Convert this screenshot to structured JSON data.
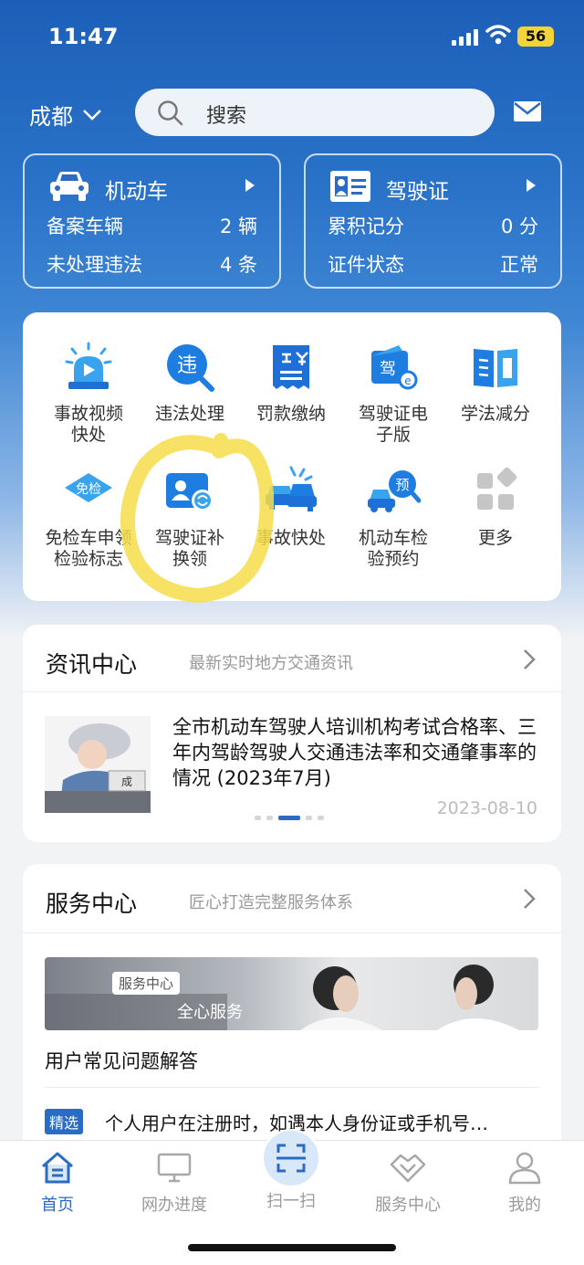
{
  "status": {
    "time": "11:47",
    "battery": "56"
  },
  "header": {
    "city": "成都",
    "search_placeholder": "搜索"
  },
  "vehicle_card": {
    "title": "机动车",
    "rows": [
      {
        "label": "备案车辆",
        "value": "2",
        "unit": "辆"
      },
      {
        "label": "未处理违法",
        "value": "4",
        "unit": "条"
      }
    ]
  },
  "license_card": {
    "title": "驾驶证",
    "rows": [
      {
        "label": "累积记分",
        "value": "0",
        "unit": "分"
      },
      {
        "label": "证件状态",
        "value": "正常",
        "unit": ""
      }
    ]
  },
  "services": [
    {
      "label": "事故视频\n快处",
      "icon": "alarm-video-icon"
    },
    {
      "label": "违法处理",
      "icon": "violation-search-icon"
    },
    {
      "label": "罚款缴纳",
      "icon": "fine-receipt-icon"
    },
    {
      "label": "驾驶证电\n子版",
      "icon": "e-license-icon"
    },
    {
      "label": "学法减分",
      "icon": "book-icon"
    },
    {
      "label": "免检车申领\n检验标志",
      "icon": "exempt-badge-icon"
    },
    {
      "label": "驾驶证补\n换领",
      "icon": "license-renew-icon"
    },
    {
      "label": "事故快处",
      "icon": "car-accident-icon"
    },
    {
      "label": "机动车检\n验预约",
      "icon": "inspection-booking-icon"
    },
    {
      "label": "更多",
      "icon": "more-grid-icon"
    }
  ],
  "news": {
    "title": "资讯中心",
    "subtitle": "最新实时地方交通资讯",
    "headline": "全市机动车驾驶人培训机构考试合格率、三年内驾龄驾驶人交通违法率和交通肇事率的情况 (2023年7月)",
    "date": "2023-08-10"
  },
  "service_center": {
    "title": "服务中心",
    "subtitle": "匠心打造完整服务体系",
    "banner_tag": "服务中心",
    "banner_caption": "全心服务",
    "faq_title": "用户常见问题解答",
    "pick_tag": "精选",
    "faq_item": "个人用户在注册时，如遇本人身份证或手机号…"
  },
  "nav": [
    {
      "label": "首页",
      "icon": "home-icon",
      "active": true
    },
    {
      "label": "网办进度",
      "icon": "monitor-icon",
      "active": false
    },
    {
      "label": "扫一扫",
      "icon": "scan-icon",
      "active": false
    },
    {
      "label": "服务中心",
      "icon": "handshake-icon",
      "active": false
    },
    {
      "label": "我的",
      "icon": "user-icon",
      "active": false
    }
  ],
  "colors": {
    "brand_blue": "#2a6bc4",
    "highlight_yellow": "#f7dd4a"
  }
}
